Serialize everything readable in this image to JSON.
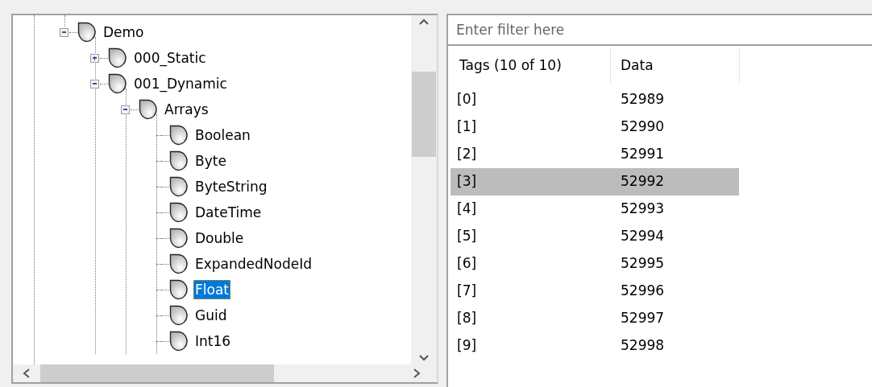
{
  "tree": [
    {
      "label": "Demo",
      "expanded": true,
      "selected": false,
      "children": [
        {
          "label": "000_Static",
          "expanded": false,
          "selected": false
        },
        {
          "label": "001_Dynamic",
          "expanded": true,
          "selected": false,
          "children": [
            {
              "label": "Arrays",
              "expanded": true,
              "selected": false,
              "children": [
                {
                  "label": "Boolean",
                  "selected": false
                },
                {
                  "label": "Byte",
                  "selected": false
                },
                {
                  "label": "ByteString",
                  "selected": false
                },
                {
                  "label": "DateTime",
                  "selected": false
                },
                {
                  "label": "Double",
                  "selected": false
                },
                {
                  "label": "ExpandedNodeId",
                  "selected": false
                },
                {
                  "label": "Float",
                  "selected": true
                },
                {
                  "label": "Guid",
                  "selected": false
                },
                {
                  "label": "Int16",
                  "selected": false
                }
              ]
            }
          ]
        }
      ]
    }
  ],
  "filter": {
    "placeholder": "Enter filter here"
  },
  "table": {
    "columns": [
      "Tags (10 of 10)",
      "Data"
    ],
    "rows": [
      {
        "tag": "[0]",
        "data": "52989",
        "selected": false
      },
      {
        "tag": "[1]",
        "data": "52990",
        "selected": false
      },
      {
        "tag": "[2]",
        "data": "52991",
        "selected": false
      },
      {
        "tag": "[3]",
        "data": "52992",
        "selected": true
      },
      {
        "tag": "[4]",
        "data": "52993",
        "selected": false
      },
      {
        "tag": "[5]",
        "data": "52994",
        "selected": false
      },
      {
        "tag": "[6]",
        "data": "52995",
        "selected": false
      },
      {
        "tag": "[7]",
        "data": "52996",
        "selected": false
      },
      {
        "tag": "[8]",
        "data": "52997",
        "selected": false
      },
      {
        "tag": "[9]",
        "data": "52998",
        "selected": false
      }
    ]
  }
}
